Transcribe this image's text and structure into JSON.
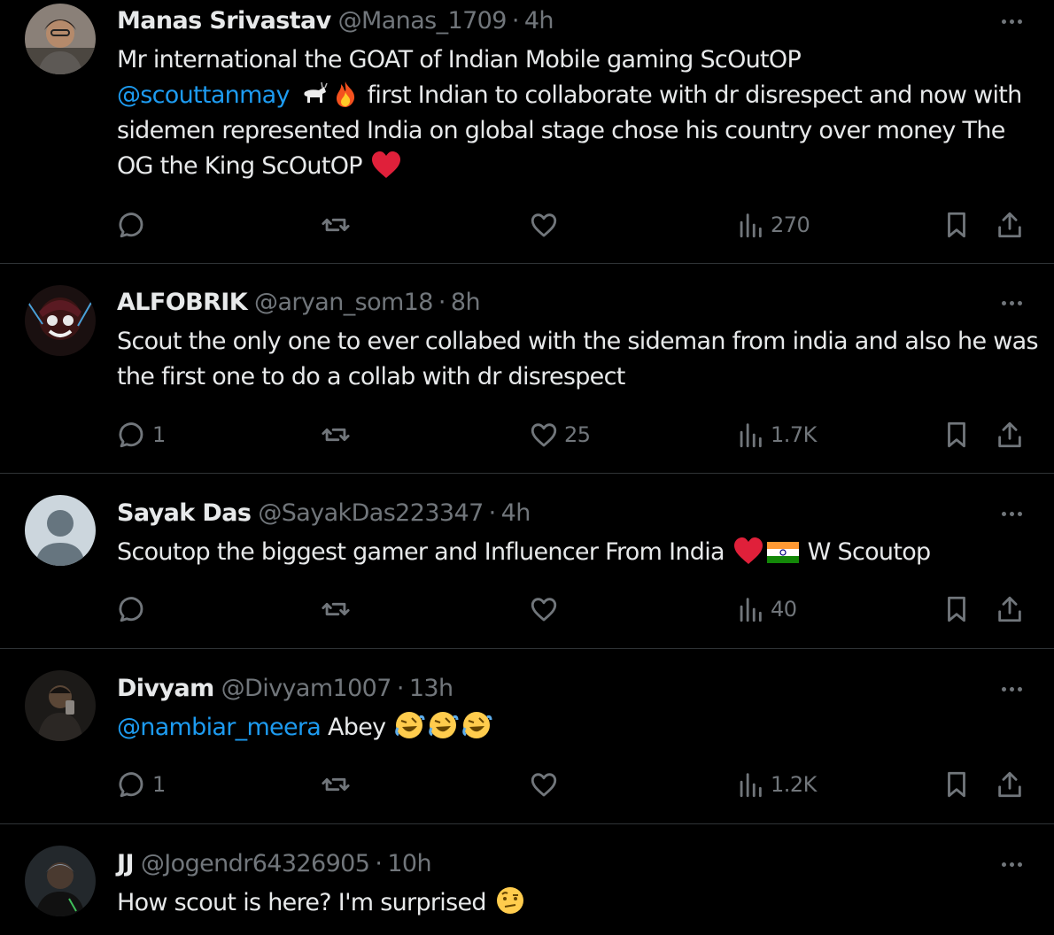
{
  "tweets": [
    {
      "name": "Manas Srivastav",
      "handle": "@Manas_1709",
      "time": "4h",
      "text_parts": [
        "Mr international the GOAT of Indian Mobile gaming ScOutOP",
        "@scouttanmay",
        "first Indian to collaborate with dr disrespect and now with sidemen represented India on global stage chose his country over money The OG the King ScOutOP"
      ],
      "replies": "",
      "likes": "",
      "views": "270"
    },
    {
      "name": "ALFOBRIK",
      "handle": "@aryan_som18",
      "time": "8h",
      "text": "Scout the only one to ever collabed with the sideman from india and also he was the first one to do a collab with dr disrespect",
      "replies": "1",
      "likes": "25",
      "views": "1.7K"
    },
    {
      "name": "Sayak Das",
      "handle": "@SayakDas223347",
      "time": "4h",
      "text_parts": [
        "Scoutop the biggest gamer and Influencer From India",
        "W Scoutop"
      ],
      "replies": "",
      "likes": "",
      "views": "40"
    },
    {
      "name": "Divyam",
      "handle": "@Divyam1007",
      "time": "13h",
      "text_parts": [
        "@nambiar_meera",
        "Abey"
      ],
      "replies": "1",
      "likes": "",
      "views": "1.2K"
    },
    {
      "name": "JJ",
      "handle": "@Jogendr64326905",
      "time": "10h",
      "text": "How scout is here? I'm surprised"
    }
  ],
  "separator": "·",
  "icons": {
    "reply": "reply-icon",
    "retweet": "retweet-icon",
    "like": "heart-icon",
    "views": "views-icon",
    "bookmark": "bookmark-icon",
    "share": "share-icon",
    "more": "more-icon"
  },
  "colors": {
    "background": "#000000",
    "text": "#e7e9ea",
    "muted": "#71767b",
    "link": "#1d9bf0",
    "divider": "#2f3336"
  }
}
